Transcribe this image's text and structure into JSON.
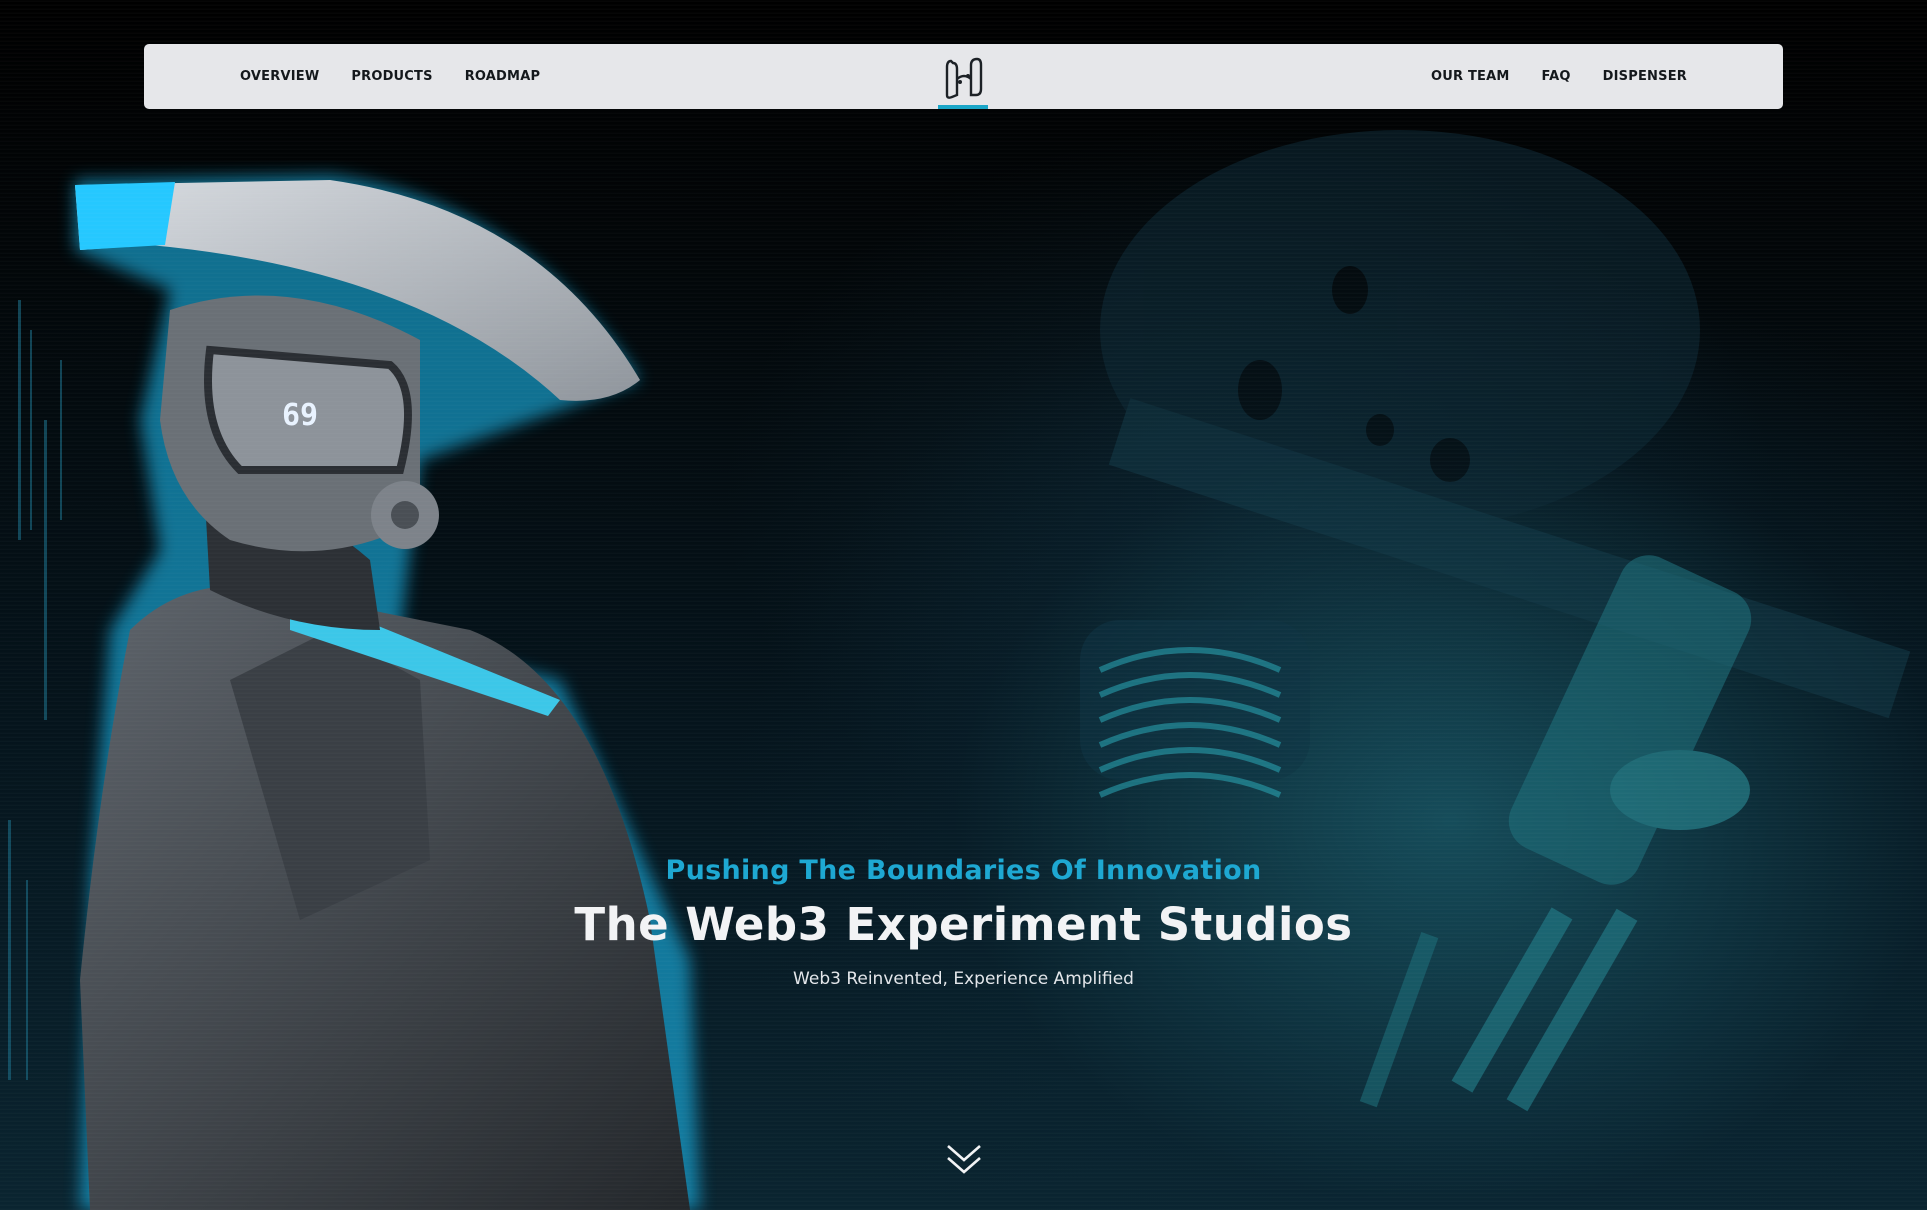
{
  "nav": {
    "left_items": [
      {
        "label": "OVERVIEW"
      },
      {
        "label": "PRODUCTS"
      },
      {
        "label": "ROADMAP"
      }
    ],
    "right_items": [
      {
        "label": "OUR TEAM"
      },
      {
        "label": "FAQ"
      },
      {
        "label": "DISPENSER"
      }
    ],
    "logo_icon": "studio-monogram-icon"
  },
  "hero": {
    "tagline": "Pushing The Boundaries Of Innovation",
    "title": "The Web3 Experiment Studios",
    "subtitle": "Web3 Reinvented, Experience Amplified",
    "scroll_icon": "double-chevron-down-icon",
    "visor_display": "69"
  },
  "colors": {
    "accent": "#1ea8d2",
    "nav_bg": "#e6e7ea",
    "page_bg": "#000000",
    "title_text": "#f2f3f5"
  }
}
